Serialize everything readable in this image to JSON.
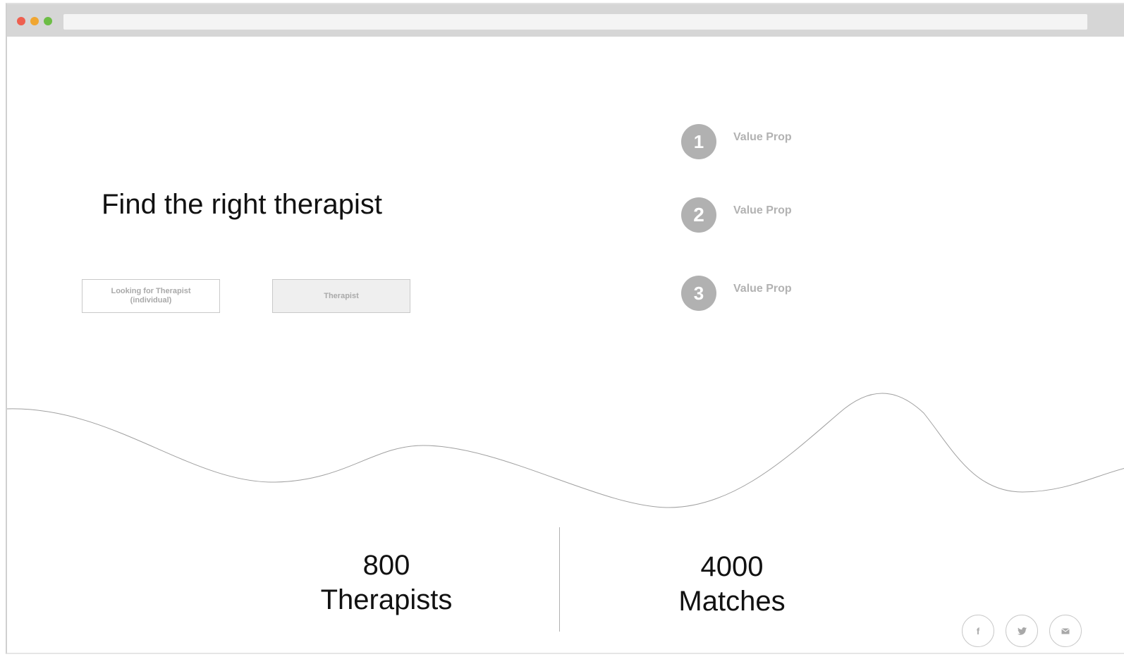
{
  "colors": {
    "dot_red": "#ee5f4f",
    "dot_yellow": "#f0a631",
    "dot_green": "#6cbd45",
    "chrome_bar": "#d6d6d6",
    "accent_grey": "#b1b1b1"
  },
  "hero": {
    "title": "Find the right therapist",
    "cta_primary": "Looking for Therapist\n(individual)",
    "cta_secondary": "Therapist"
  },
  "value_props": [
    {
      "number": "1",
      "label": "Value Prop"
    },
    {
      "number": "2",
      "label": "Value Prop"
    },
    {
      "number": "3",
      "label": "Value Prop"
    }
  ],
  "stats": [
    {
      "value": "800",
      "label": "Therapists"
    },
    {
      "value": "4000",
      "label": "Matches"
    }
  ],
  "social": [
    {
      "icon": "facebook-icon",
      "glyph": "f"
    },
    {
      "icon": "twitter-icon",
      "glyph": "♥"
    },
    {
      "icon": "email-icon",
      "glyph": "✉"
    }
  ]
}
